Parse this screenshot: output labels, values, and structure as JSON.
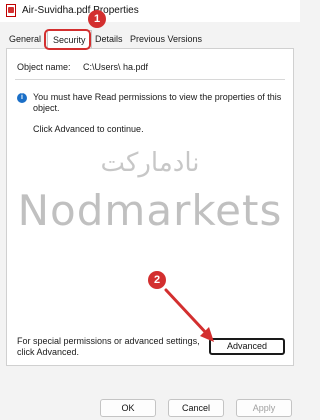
{
  "window": {
    "title": "Air-Suvidha.pdf Properties"
  },
  "tabs": [
    {
      "label": "General"
    },
    {
      "label": "Security"
    },
    {
      "label": "Details"
    },
    {
      "label": "Previous Versions"
    }
  ],
  "security": {
    "object_name_label": "Object name:",
    "object_name_value": "C:\\Users\\                ha.pdf",
    "info_message": "You must have Read permissions to view the properties of this object.",
    "continue_text": "Click Advanced to continue.",
    "advanced_text": "For special permissions or advanced settings, click Advanced.",
    "advanced_button": "Advanced"
  },
  "buttons": {
    "ok": "OK",
    "cancel": "Cancel",
    "apply": "Apply"
  },
  "watermark": {
    "arabic": "نادماركت",
    "latin": "Nodmarkets"
  },
  "annotations": {
    "step1": "1",
    "step2": "2"
  },
  "colors": {
    "annotation": "#d32f2f",
    "info_icon": "#1b6fc7"
  }
}
